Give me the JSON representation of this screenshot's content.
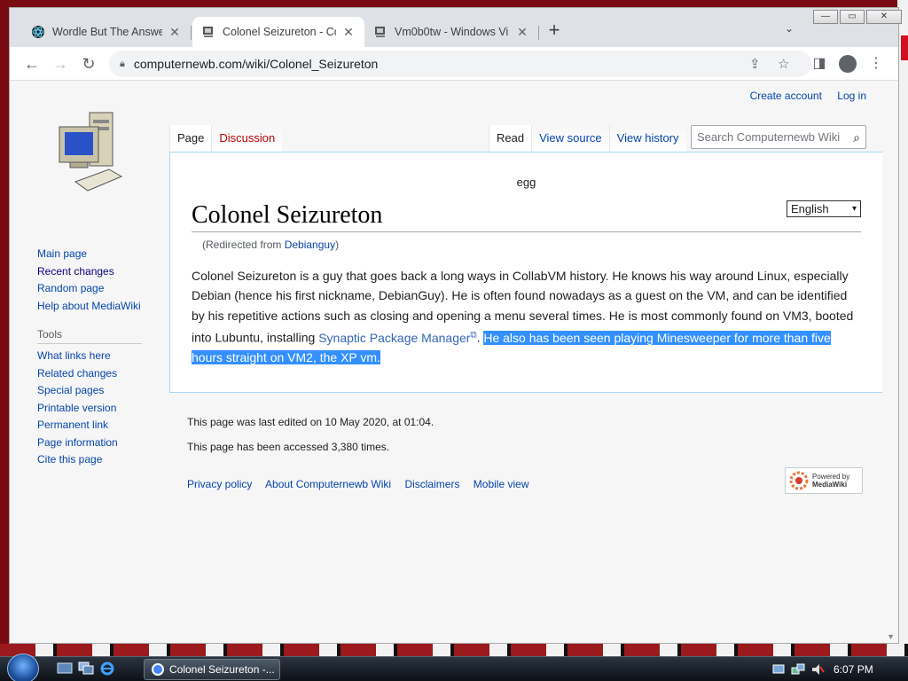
{
  "browser": {
    "tabs": [
      {
        "title": "Wordle But The Answer",
        "active": false
      },
      {
        "title": "Colonel Seizureton - Co",
        "active": true
      },
      {
        "title": "Vm0b0tw - Windows Vi",
        "active": false
      }
    ],
    "new_tab": "+",
    "tab_search": "⌄",
    "window_buttons": {
      "minimize": "—",
      "maximize": "▭",
      "close": "✕"
    },
    "url": "computernewb.com/wiki/Colonel_Seizureton"
  },
  "personal": {
    "create_account": "Create account",
    "log_in": "Log in"
  },
  "wiki_tabs": {
    "left": [
      {
        "label": "Page",
        "selected": true
      },
      {
        "label": "Discussion",
        "selected": false
      }
    ],
    "right": [
      {
        "label": "Read",
        "selected": true
      },
      {
        "label": "View source",
        "selected": false
      },
      {
        "label": "View history",
        "selected": false
      }
    ]
  },
  "search": {
    "placeholder": "Search Computernewb Wiki"
  },
  "sidebar": {
    "navigation": [
      "Main page",
      "Recent changes",
      "Random page",
      "Help about MediaWiki"
    ],
    "tools_heading": "Tools",
    "tools": [
      "What links here",
      "Related changes",
      "Special pages",
      "Printable version",
      "Permanent link",
      "Page information",
      "Cite this page"
    ]
  },
  "content": {
    "sitenotice": "egg",
    "language": "English",
    "title": "Colonel Seizureton",
    "redirect_prefix": "(Redirected from ",
    "redirect_link": "Debianguy",
    "redirect_suffix": ")",
    "body_part1": "Colonel Seizureton is a guy that goes back a long ways in CollabVM history. He knows his way around Linux, especially Debian (hence his first nickname, DebianGuy). He is often found nowadays as a guest on the VM, and can be identified by his repetitive actions such as closing and opening a menu several times. He is most commonly found on VM3, booted into Lubuntu, installing ",
    "body_link": "Synaptic Package Manager",
    "body_part2": ". ",
    "body_selected": "He also has been seen playing Minesweeper for more than five hours straight on VM2, the XP vm."
  },
  "footer": {
    "last_edited": "This page was last edited on 10 May 2020, at 01:04.",
    "accessed": "This page has been accessed 3,380 times.",
    "links": [
      "Privacy policy",
      "About Computernewb Wiki",
      "Disclaimers",
      "Mobile view"
    ],
    "powered_line1": "Powered by",
    "powered_line2": "MediaWiki"
  },
  "taskbar": {
    "task_title": "Colonel Seizureton -...",
    "clock": "6:07 PM"
  },
  "colors": {
    "link": "#0645ad",
    "new_link": "#ba0000",
    "selection": "#3390ff"
  }
}
